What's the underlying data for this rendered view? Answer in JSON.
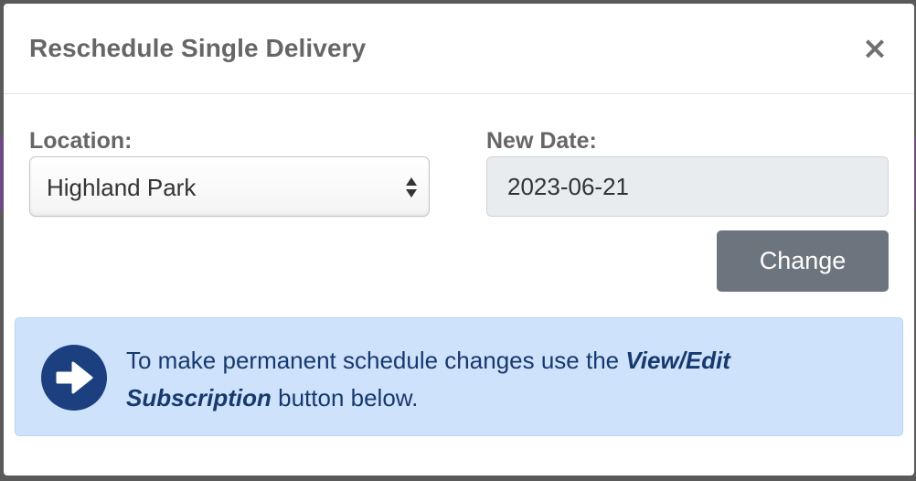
{
  "modal": {
    "title": "Reschedule Single Delivery",
    "close_symbol": "×"
  },
  "form": {
    "location_label": "Location:",
    "location_value": "Highland Park",
    "date_label": "New Date:",
    "date_value": "2023-06-21",
    "change_label": "Change"
  },
  "alert": {
    "icon": "arrow-right-circle-icon",
    "text_before": "To make permanent schedule changes use the ",
    "emphasis": "View/Edit Subscription",
    "text_after": " button below."
  },
  "colors": {
    "alert_background": "#cfe2fc",
    "alert_text": "#16396e",
    "button_secondary": "#6c757d"
  }
}
